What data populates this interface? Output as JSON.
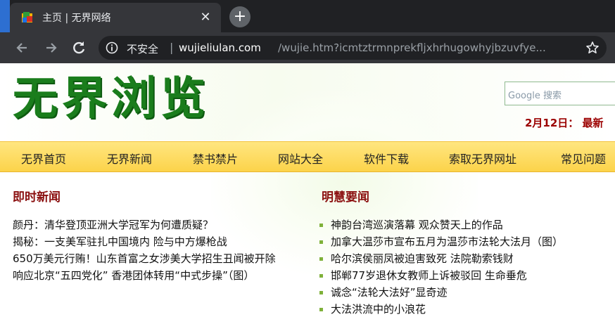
{
  "browser": {
    "tab_title": "主页 | 无界网络",
    "tab_close": "✕",
    "new_tab": "+",
    "security_label": "不安全",
    "separator": "|",
    "url_domain": "wujieliulan.com",
    "url_path": "/wujie.htm?icmtztrmnprekfljxhrhugowhyjbzuvfye...",
    "icons": [
      "favicon",
      "back-icon",
      "forward-icon",
      "reload-icon",
      "info-icon",
      "star-icon"
    ]
  },
  "header": {
    "logo_text": "无界浏览",
    "search_placeholder": "Google 搜索",
    "date_text": "2月12日：  最新"
  },
  "menu": {
    "items": [
      "无界首页",
      "无界新闻",
      "禁书禁片",
      "网站大全",
      "软件下载",
      "索取无界网址",
      "常见问题"
    ]
  },
  "sections": {
    "left_title": "即时新闻",
    "right_title": "明慧要闻",
    "left_items": [
      "颜丹：清华登顶亚洲大学冠军为何遭质疑？",
      "揭秘：一支美军驻扎中国境内  险与中方爆枪战",
      "650万美元行贿！山东首富之女涉美大学招生丑闻被开除",
      "响应北京“五四党化”  香港团体转用“中式步操”（图）"
    ],
    "right_items": [
      "神韵台湾巡演落幕  观众赞天上的作品",
      "加拿大温莎市宣布五月为温莎市法轮大法月（图）",
      "哈尔滨侯丽凤被迫害致死   法院勒索钱财",
      "邯郸77岁退休女教师上诉被驳回   生命垂危",
      "诚念“法轮大法好”显奇迹",
      "大法洪流中的小浪花"
    ]
  },
  "colors": {
    "chrome_dark": "#202124",
    "chrome_tab": "#35363a",
    "logo_green": "#1a7d1c",
    "menu_yellow": "#fcd34a",
    "section_red": "#8b1010",
    "bullet_green": "#7fb13a"
  }
}
